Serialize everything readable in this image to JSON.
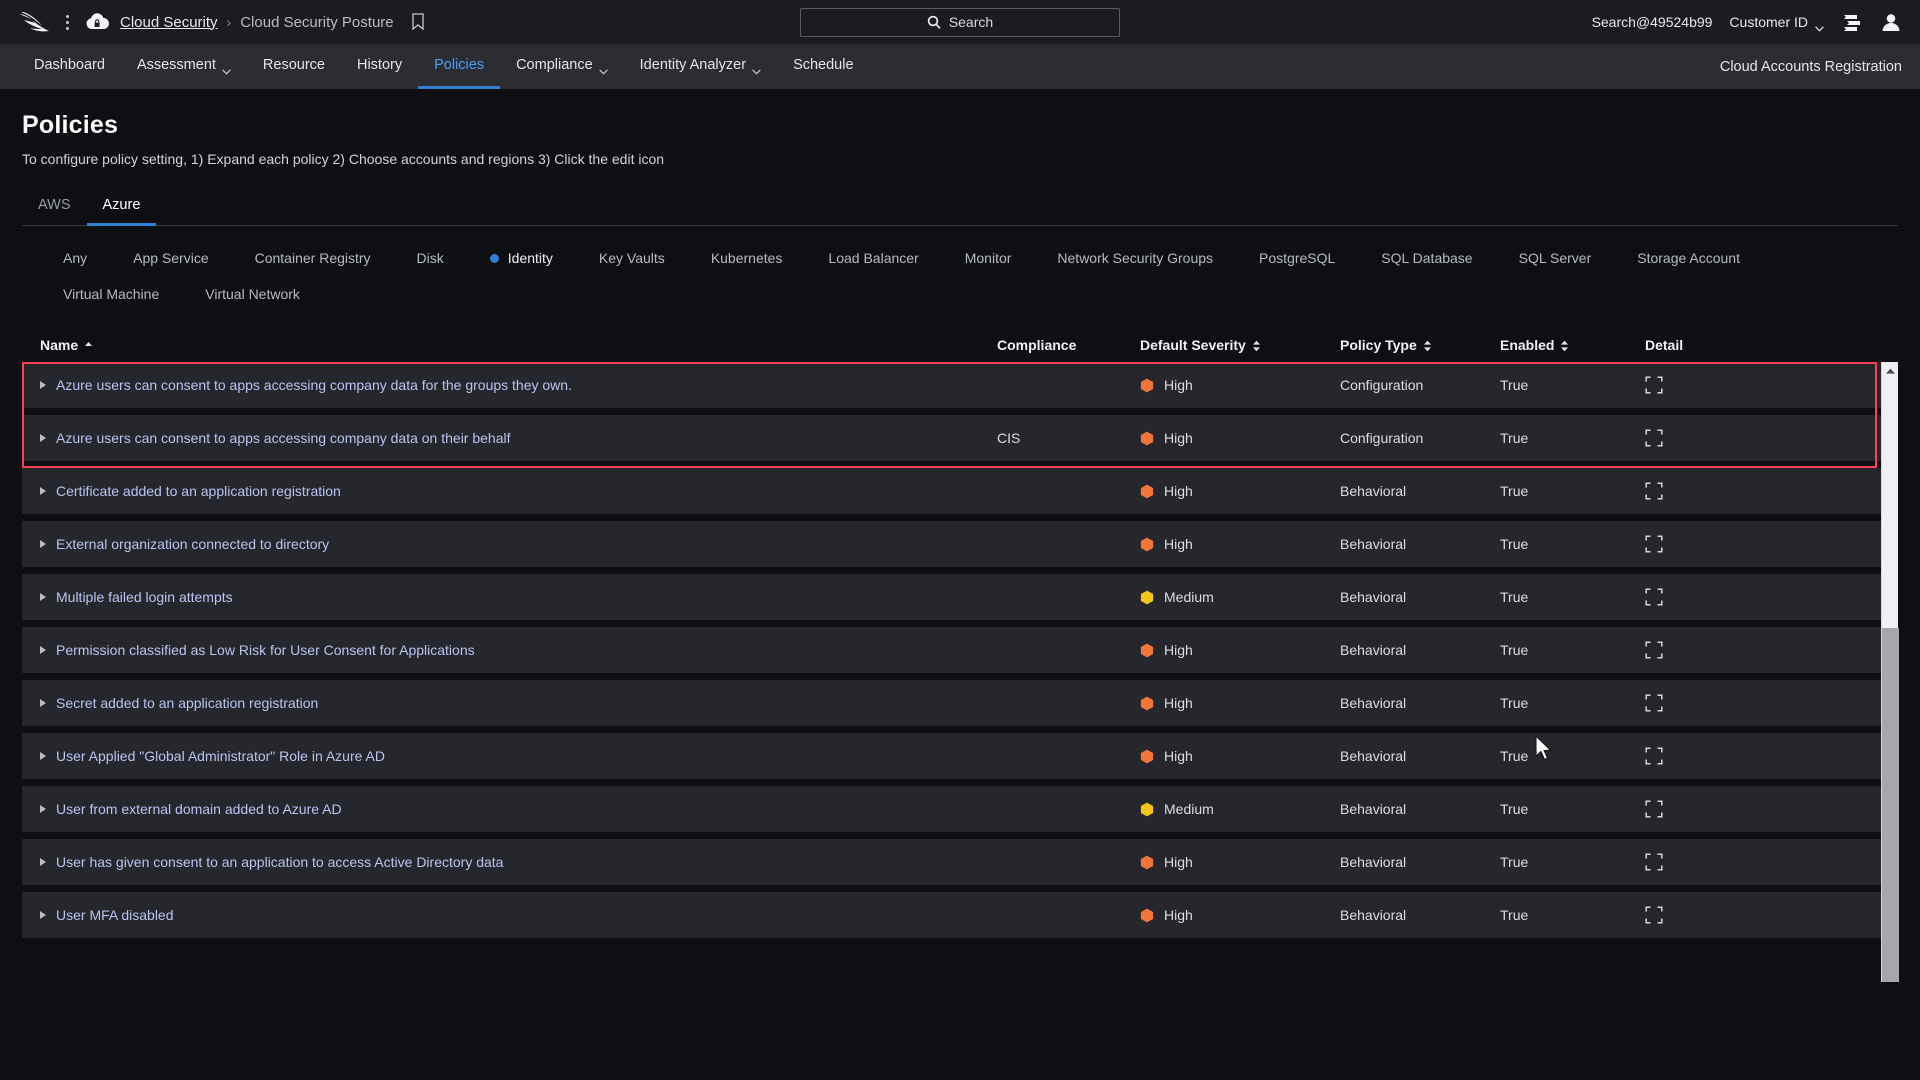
{
  "topbar": {
    "logo_icon": "falcon-logo",
    "menu_icon": "kebab-menu-icon",
    "product_icon": "cloud-lock-icon",
    "breadcrumb_root": "Cloud Security",
    "breadcrumb_sep": "›",
    "breadcrumb_current": "Cloud Security Posture",
    "bookmark_icon": "bookmark-icon",
    "search_placeholder": "Search",
    "search_icon": "search-icon",
    "user_account": "Search@49524b99",
    "customer_id_label": "Customer ID",
    "customer_id_chevron": "chevron-down-icon",
    "list_icon": "list-view-icon",
    "avatar_icon": "user-avatar-icon"
  },
  "nav": {
    "items": [
      {
        "label": "Dashboard",
        "has_chevron": false,
        "active": false
      },
      {
        "label": "Assessment",
        "has_chevron": true,
        "active": false
      },
      {
        "label": "Resource",
        "has_chevron": false,
        "active": false
      },
      {
        "label": "History",
        "has_chevron": false,
        "active": false
      },
      {
        "label": "Policies",
        "has_chevron": false,
        "active": true
      },
      {
        "label": "Compliance",
        "has_chevron": true,
        "active": false
      },
      {
        "label": "Identity Analyzer",
        "has_chevron": true,
        "active": false
      },
      {
        "label": "Schedule",
        "has_chevron": false,
        "active": false
      }
    ],
    "right_link": "Cloud Accounts Registration"
  },
  "page": {
    "title": "Policies",
    "subtitle": "To configure policy setting, 1) Expand each policy 2) Choose accounts and regions 3) Click the edit icon"
  },
  "cloud_tabs": [
    {
      "label": "AWS",
      "active": false
    },
    {
      "label": "Azure",
      "active": true
    }
  ],
  "service_tabs": [
    {
      "label": "Any",
      "active": false
    },
    {
      "label": "App Service",
      "active": false
    },
    {
      "label": "Container Registry",
      "active": false
    },
    {
      "label": "Disk",
      "active": false
    },
    {
      "label": "Identity",
      "active": true
    },
    {
      "label": "Key Vaults",
      "active": false
    },
    {
      "label": "Kubernetes",
      "active": false
    },
    {
      "label": "Load Balancer",
      "active": false
    },
    {
      "label": "Monitor",
      "active": false
    },
    {
      "label": "Network Security Groups",
      "active": false
    },
    {
      "label": "PostgreSQL",
      "active": false
    },
    {
      "label": "SQL Database",
      "active": false
    },
    {
      "label": "SQL Server",
      "active": false
    },
    {
      "label": "Storage Account",
      "active": false
    },
    {
      "label": "Virtual Machine",
      "active": false
    },
    {
      "label": "Virtual Network",
      "active": false
    }
  ],
  "table": {
    "columns": [
      {
        "key": "name",
        "label": "Name",
        "sort": "asc"
      },
      {
        "key": "comp",
        "label": "Compliance",
        "sort": "none"
      },
      {
        "key": "severity",
        "label": "Default Severity",
        "sort": "both"
      },
      {
        "key": "ptype",
        "label": "Policy Type",
        "sort": "both"
      },
      {
        "key": "enabled",
        "label": "Enabled",
        "sort": "both"
      },
      {
        "key": "detail",
        "label": "Detail",
        "sort": "none"
      }
    ],
    "detail_icon": "expand-detail-icon",
    "expander_icon": "caret-right-icon",
    "rows": [
      {
        "name": "Azure users can consent to apps accessing company data for the groups they own.",
        "compliance": "",
        "severity": "High",
        "severity_color": "#f2763a",
        "policy_type": "Configuration",
        "enabled": "True",
        "highlighted": true
      },
      {
        "name": "Azure users can consent to apps accessing company data on their behalf",
        "compliance": "CIS",
        "severity": "High",
        "severity_color": "#f2763a",
        "policy_type": "Configuration",
        "enabled": "True",
        "highlighted": true
      },
      {
        "name": "Certificate added to an application registration",
        "compliance": "",
        "severity": "High",
        "severity_color": "#f2763a",
        "policy_type": "Behavioral",
        "enabled": "True",
        "highlighted": false
      },
      {
        "name": "External organization connected to directory",
        "compliance": "",
        "severity": "High",
        "severity_color": "#f2763a",
        "policy_type": "Behavioral",
        "enabled": "True",
        "highlighted": false
      },
      {
        "name": "Multiple failed login attempts",
        "compliance": "",
        "severity": "Medium",
        "severity_color": "#f5c518",
        "policy_type": "Behavioral",
        "enabled": "True",
        "highlighted": false
      },
      {
        "name": "Permission classified as Low Risk for User Consent for Applications",
        "compliance": "",
        "severity": "High",
        "severity_color": "#f2763a",
        "policy_type": "Behavioral",
        "enabled": "True",
        "highlighted": false
      },
      {
        "name": "Secret added to an application registration",
        "compliance": "",
        "severity": "High",
        "severity_color": "#f2763a",
        "policy_type": "Behavioral",
        "enabled": "True",
        "highlighted": false
      },
      {
        "name": "User Applied \"Global Administrator\" Role in Azure AD",
        "compliance": "",
        "severity": "High",
        "severity_color": "#f2763a",
        "policy_type": "Behavioral",
        "enabled": "True",
        "highlighted": false
      },
      {
        "name": "User from external domain added to Azure AD",
        "compliance": "",
        "severity": "Medium",
        "severity_color": "#f5c518",
        "policy_type": "Behavioral",
        "enabled": "True",
        "highlighted": false
      },
      {
        "name": "User has given consent to an application to access Active Directory data",
        "compliance": "",
        "severity": "High",
        "severity_color": "#f2763a",
        "policy_type": "Behavioral",
        "enabled": "True",
        "highlighted": false
      },
      {
        "name": "User MFA disabled",
        "compliance": "",
        "severity": "High",
        "severity_color": "#f2763a",
        "policy_type": "Behavioral",
        "enabled": "True",
        "highlighted": false
      }
    ]
  },
  "scrollbar": {
    "up_arrow_icon": "scroll-up-arrow-icon"
  },
  "colors": {
    "accent": "#2f7fd8",
    "highlight": "#fb4058",
    "link": "#b9c4f2"
  }
}
